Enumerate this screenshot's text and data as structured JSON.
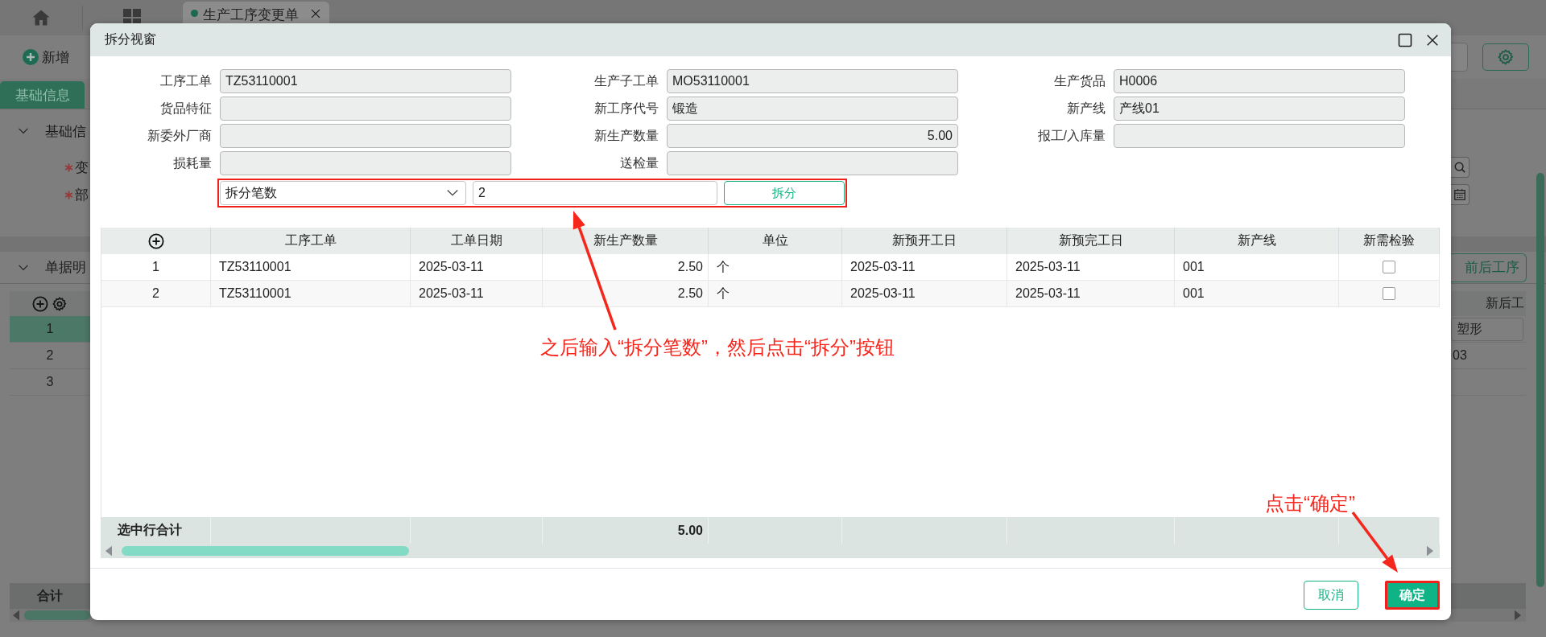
{
  "background": {
    "document_tab": {
      "label": "生产工序变更单",
      "selected": true
    },
    "add_button": "新增",
    "form_tabs": [
      {
        "label": "基础信息",
        "selected": true
      }
    ],
    "sections": [
      {
        "title": "基础信",
        "expanded": true
      },
      {
        "title": "单据明",
        "expanded": true
      }
    ],
    "required_fields": [
      {
        "label": "变",
        "required": true
      },
      {
        "label": "部",
        "required": true
      }
    ],
    "detail_button": "前后工序",
    "grid": {
      "column_header": "新后工",
      "footer": "合计",
      "rows": [
        {
          "number": "1",
          "selected": true,
          "cell": "塑形"
        },
        {
          "number": "2",
          "selected": false,
          "cell": "03"
        },
        {
          "number": "3",
          "selected": false
        }
      ]
    }
  },
  "dialog": {
    "title": "拆分视窗",
    "form_rows": [
      [
        {
          "label": "工序工单",
          "value": "TZ53110001",
          "kind": "text"
        },
        {
          "label": "生产子工单",
          "value": "MO53110001",
          "kind": "text"
        },
        {
          "label": "生产货品",
          "value": "H0006",
          "kind": "text"
        }
      ],
      [
        {
          "label": "货品特征",
          "kind": "text"
        },
        {
          "label": "新工序代号",
          "value": "锻造",
          "kind": "text"
        },
        {
          "label": "新产线",
          "value": "产线01",
          "kind": "text"
        }
      ],
      [
        {
          "label": "新委外厂商",
          "kind": "text"
        },
        {
          "label": "新生产数量",
          "value": "5.00",
          "kind": "number"
        },
        {
          "label": "报工/入库量",
          "kind": "text"
        }
      ],
      [
        {
          "label": "损耗量",
          "kind": "text"
        },
        {
          "label": "送检量",
          "kind": "text"
        }
      ]
    ],
    "split": {
      "mode": "拆分笔数",
      "count": "2",
      "button": "拆分",
      "highlighted": true
    },
    "table": {
      "columns": [
        {
          "label": "工序工单",
          "kind": "text"
        },
        {
          "label": "工单日期",
          "kind": "text"
        },
        {
          "label": "新生产数量",
          "kind": "number"
        },
        {
          "label": "单位",
          "kind": "text"
        },
        {
          "label": "新预开工日",
          "kind": "text"
        },
        {
          "label": "新预完工日",
          "kind": "text"
        },
        {
          "label": "新产线",
          "kind": "text"
        },
        {
          "label": "新需检验",
          "kind": "checkbox"
        }
      ],
      "rows": [
        {
          "number": "1",
          "cells": [
            "TZ53110001",
            "2025-03-11",
            "2.50",
            "个",
            "2025-03-11",
            "2025-03-11",
            "001"
          ],
          "inspection_required": false
        },
        {
          "number": "2",
          "cells": [
            "TZ53110001",
            "2025-03-11",
            "2.50",
            "个",
            "2025-03-11",
            "2025-03-11",
            "001"
          ],
          "inspection_required": false
        }
      ],
      "footer": {
        "label": "选中行合计",
        "total": "5.00"
      }
    },
    "buttons": [
      {
        "label": "取消",
        "kind": "secondary",
        "highlighted": false
      },
      {
        "label": "确定",
        "kind": "primary",
        "highlighted": true
      }
    ],
    "annotations": [
      {
        "text": "之后输入“拆分笔数”，然后点击“拆分”按钮"
      },
      {
        "text": "点击“确定”"
      }
    ]
  }
}
